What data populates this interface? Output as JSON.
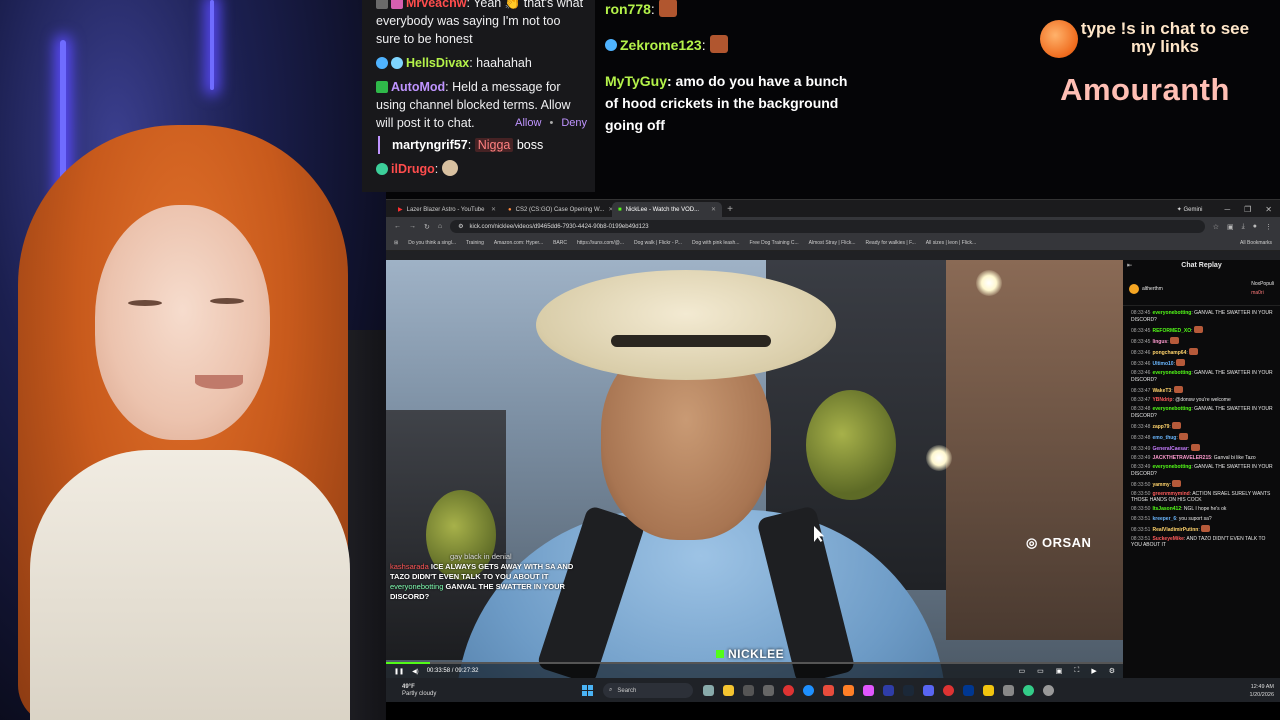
{
  "overlay_chat": {
    "partial_user": "Mrveachw",
    "partial_text": ": Yeah 👏 that's what everybody was saying I'm not too sure to be honest",
    "msg2_user": "HellsDivax",
    "msg2_text": ": haahahah",
    "automod_user": "AutoMod",
    "automod_text": ": Held a message for using channel blocked terms. Allow will post it to chat.",
    "allow_label": "Allow",
    "deny_label": "Deny",
    "held_user": "martyngrif57",
    "held_term": "Nigga",
    "held_rest": "boss",
    "msg4_user": "ilDrugo",
    "colors": {
      "red_name": "#ff4d4d",
      "automod": "#bf94ff",
      "green_name": "#b4f24a"
    }
  },
  "right_chat": {
    "m1_user": "ron778",
    "m2_user": "Zekrome123",
    "m3_user": "MyTyGuy",
    "m3_text": ": amo do you have a bunch of hood crickets in the background going off"
  },
  "branding": {
    "links_text": "type !s in chat to see my links",
    "streamer": "Amouranth"
  },
  "browser": {
    "tabs": [
      {
        "label": "Lazer Blazer Astro - YouTube"
      },
      {
        "label": "CS2 (CS:GO) Case Opening W..."
      },
      {
        "label": "NickLee - Watch the VOD..."
      }
    ],
    "gemini_label": "Gemini",
    "url": "kick.com/nicklee/videos/d9465dd6-7930-4424-90b8-0199eb49d123",
    "bookmarks": [
      "Do you think a singl...",
      "Training",
      "Amazon.com: Hyper...",
      "BARC",
      "https://suns.com/@...",
      "Dog walk | Flickr - P...",
      "Dog with pink leash...",
      "Free Dog Training C...",
      "Almost Stray | Flick...",
      "Ready for walkies | F...",
      "All sizes | leon | Flick..."
    ],
    "all_bookmarks": "All Bookmarks"
  },
  "video": {
    "sign_text": "ORSAN",
    "streamer_tag": "NICKLEE",
    "time_current": "00:33:58",
    "time_total": "09:27:32",
    "progress": 0.06,
    "vod_chat": {
      "line1": "gay black in denial",
      "line2_user": "kashsarada",
      "line2_text": "ICE ALWAYS GETS AWAY WITH SA AND TAZO DIDN'T EVEN TALK TO YOU ABOUT IT",
      "line3_user": "everyonebotting",
      "line3_text": "GANVAL THE SWATTER IN YOUR DISCORD?"
    }
  },
  "chat_replay": {
    "title": "Chat Replay",
    "pinned_left": "altherthm",
    "pinned_right": "NoxPopuli",
    "pinned_right2": "ma0ri",
    "rows": [
      {
        "ts": "08:33:45",
        "user": "everyonebotting",
        "color": "#53fc18",
        "text": "GANVAL THE SWATTER IN YOUR DISCORD?"
      },
      {
        "ts": "08:33:45",
        "user": "REFORMED_XO",
        "color": "#53fc18",
        "text": ""
      },
      {
        "ts": "08:33:45",
        "user": "lingus",
        "color": "#ff9bd0",
        "text": ""
      },
      {
        "ts": "08:33:46",
        "user": "pongchamp64",
        "color": "#ffd36b",
        "text": ""
      },
      {
        "ts": "08:33:46",
        "user": "Ultimo10",
        "color": "#6bb8ff",
        "text": ""
      },
      {
        "ts": "08:33:46",
        "user": "everyonebotting",
        "color": "#53fc18",
        "text": "GANVAL THE SWATTER IN YOUR DISCORD?"
      },
      {
        "ts": "08:33:47",
        "user": "WakeT3",
        "color": "#ffd36b",
        "text": ""
      },
      {
        "ts": "08:33:47",
        "user": "YBNdrip",
        "color": "#ff5c5c",
        "text": "@donsw you're welcome"
      },
      {
        "ts": "08:33:48",
        "user": "everyonebotting",
        "color": "#53fc18",
        "text": "GANVAL THE SWATTER IN YOUR DISCORD?"
      },
      {
        "ts": "08:33:48",
        "user": "zapp79",
        "color": "#ffd36b",
        "text": ""
      },
      {
        "ts": "08:33:48",
        "user": "emo_thug",
        "color": "#6bb8ff",
        "text": ""
      },
      {
        "ts": "08:33:49",
        "user": "GeneralCaesar",
        "color": "#c77dff",
        "text": ""
      },
      {
        "ts": "08:33:49",
        "user": "JACKTHETRAVELER215",
        "color": "#ff9bd0",
        "text": "Ganval bi like Tazo"
      },
      {
        "ts": "08:33:49",
        "user": "everyonebotting",
        "color": "#53fc18",
        "text": "GANVAL THE SWATTER IN YOUR DISCORD?"
      },
      {
        "ts": "08:33:50",
        "user": "yammy",
        "color": "#ffd36b",
        "text": ""
      },
      {
        "ts": "08:33:50",
        "user": "greenmmymind",
        "color": "#ff5c5c",
        "text": "ACTION ISRAEL SURELY WANTS THOSE HANDS ON HIS COCK"
      },
      {
        "ts": "08:33:50",
        "user": "ItsJason412",
        "color": "#53fc18",
        "text": "NGL I hope he's ok"
      },
      {
        "ts": "08:33:51",
        "user": "kreeper_6",
        "color": "#6bb8ff",
        "text": "you suport sa?"
      },
      {
        "ts": "08:33:51",
        "user": "RealVladimirPutinn",
        "color": "#ffd36b",
        "text": ""
      },
      {
        "ts": "08:33:51",
        "user": "SuckeyeMike",
        "color": "#ff5c5c",
        "text": "AND TAZO DIDN'T EVEN TALK TO YOU ABOUT IT"
      }
    ]
  },
  "taskbar": {
    "weather_temp": "49°F",
    "weather_desc": "Partly cloudy",
    "search_placeholder": "Search",
    "time": "12:49 AM",
    "date": "1/20/2026"
  }
}
